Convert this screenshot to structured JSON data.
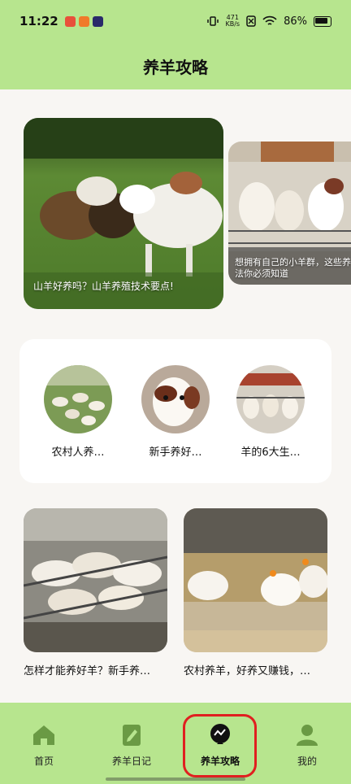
{
  "status": {
    "time": "11:22",
    "speed_top": "471",
    "speed_bottom": "KB/s",
    "battery": "86%"
  },
  "header": {
    "title": "养羊攻略"
  },
  "banners": [
    {
      "caption": "山羊好养吗？山羊养殖技术要点!"
    },
    {
      "caption_line1": "想拥有自己的小羊群，这些养",
      "caption_line2": "法你必须知道"
    }
  ],
  "circles": [
    {
      "label": "农村人养…"
    },
    {
      "label": "新手养好…"
    },
    {
      "label": "羊的6大生…"
    }
  ],
  "articles": [
    {
      "label": "怎样才能养好羊？新手养…"
    },
    {
      "label": "农村养羊，好养又赚钱，…"
    }
  ],
  "tabs": [
    {
      "label": "首页",
      "icon": "home-icon"
    },
    {
      "label": "养羊日记",
      "icon": "diary-icon"
    },
    {
      "label": "养羊攻略",
      "icon": "guide-icon"
    },
    {
      "label": "我的",
      "icon": "profile-icon"
    }
  ],
  "colors": {
    "accent": "#b7e58e",
    "highlight": "#e02020"
  }
}
